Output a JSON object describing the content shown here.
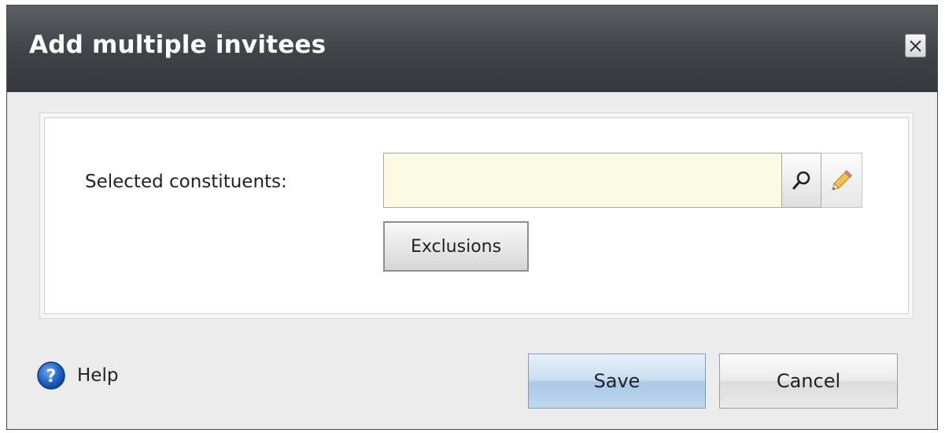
{
  "dialog": {
    "title": "Add multiple invitees",
    "close_icon": "close-icon"
  },
  "form": {
    "selected_constituents_label": "Selected constituents:",
    "selected_constituents_value": "",
    "search_icon": "search-icon",
    "edit_icon": "pencil-icon",
    "exclusions_label": "Exclusions"
  },
  "footer": {
    "help_label": "Help",
    "help_icon": "help-icon",
    "save_label": "Save",
    "cancel_label": "Cancel"
  },
  "colors": {
    "titlebar": "#3f4347",
    "input_background": "#fbfbe3",
    "save_button": "#c9ddf1",
    "help_icon": "#1e64c8"
  }
}
